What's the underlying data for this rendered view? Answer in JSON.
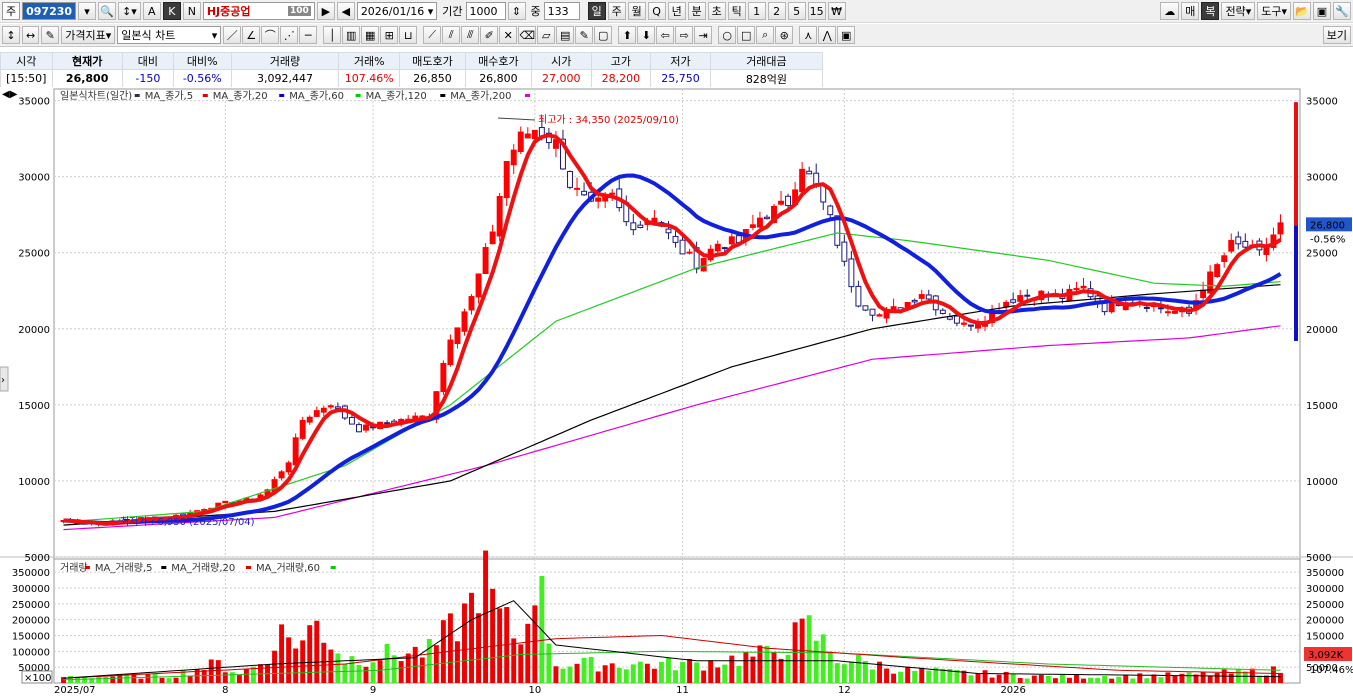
{
  "toolbar": {
    "market": "주",
    "code": "097230",
    "btn_a": "A",
    "btn_k": "K",
    "btn_n": "N",
    "stock_name": "HJ중공업",
    "name_badge": "100",
    "date": "2026/01/16",
    "period_label": "기간",
    "period_value": "1000",
    "mid_label": "중",
    "mid_value": "133",
    "intervals": [
      "일",
      "주",
      "월",
      "Q",
      "년",
      "분",
      "초",
      "틱",
      "1",
      "2",
      "5",
      "15",
      "₩"
    ],
    "right_buttons": [
      "매",
      "복",
      "전략",
      "도구"
    ],
    "indicator_btn": "가격지표",
    "chart_type": "일본식 차트",
    "view_btn": "보기"
  },
  "quote": {
    "headers": [
      "시각",
      "현재가",
      "대비",
      "대비%",
      "거래량",
      "거래%",
      "매도호가",
      "매수호가",
      "시가",
      "고가",
      "저가",
      "거래대금"
    ],
    "values": [
      "[15:50]",
      "26,800",
      "-150",
      "-0.56%",
      "3,092,447",
      "107.46%",
      "26,850",
      "26,800",
      "27,000",
      "28,200",
      "25,750",
      "828억원"
    ]
  },
  "price_legend": [
    {
      "text": "일본식차트(일간)",
      "color": "#333333"
    },
    {
      "text": "MA_종가,5",
      "color": "#e00000"
    },
    {
      "text": "MA_종가,20",
      "color": "#0000dd"
    },
    {
      "text": "MA_종가,60",
      "color": "#00cc00"
    },
    {
      "text": "MA_종가,120",
      "color": "#000000"
    },
    {
      "text": "MA_종가,200",
      "color": "#dd00dd"
    }
  ],
  "volume_legend": [
    {
      "text": "거래량",
      "color": "#e00000"
    },
    {
      "text": "MA_거래량,5",
      "color": "#000000"
    },
    {
      "text": "MA_거래량,20",
      "color": "#e00000"
    },
    {
      "text": "MA_거래량,60",
      "color": "#00cc00"
    }
  ],
  "annotations": {
    "high": "최고가 : 34,350 (2025/09/10)",
    "low": "최저가 : 6,950 (2025/07/04)",
    "price_tag": "26,800",
    "pct_tag": "-0.56%",
    "vol_tag": "3,092K",
    "vol_pct_tag": "107.46%",
    "vol_scale": "×100"
  },
  "colors": {
    "up": "#ff0000",
    "down": "#ffffff",
    "ma5": "#ee1111",
    "ma20": "#1020dd",
    "ma60": "#22cc22",
    "ma120": "#000000",
    "ma200": "#dd00dd"
  },
  "chart_data": {
    "type": "candlestick",
    "title": "일본식차트(일간)",
    "x_ticks": [
      "2025/07",
      "8",
      "9",
      "10",
      "11",
      "12",
      "2026"
    ],
    "y_ticks": [
      5000,
      10000,
      15000,
      20000,
      25000,
      30000,
      35000
    ],
    "ylim": [
      5000,
      35500
    ],
    "volume_ticks": [
      50000,
      100000,
      150000,
      200000,
      250000,
      300000,
      350000
    ],
    "volume_ylim": [
      0,
      360000
    ],
    "grid": true,
    "close_anchors": [
      [
        0,
        7400
      ],
      [
        5,
        7150
      ],
      [
        10,
        7500
      ],
      [
        15,
        7600
      ],
      [
        18,
        7900
      ],
      [
        20,
        8200
      ],
      [
        24,
        8650
      ],
      [
        27,
        8800
      ],
      [
        29,
        9400
      ],
      [
        32,
        11300
      ],
      [
        34,
        14000
      ],
      [
        36,
        14600
      ],
      [
        38,
        15100
      ],
      [
        40,
        14200
      ],
      [
        42,
        13400
      ],
      [
        46,
        13800
      ],
      [
        49,
        14100
      ],
      [
        52,
        14250
      ],
      [
        55,
        19500
      ],
      [
        58,
        22000
      ],
      [
        61,
        26500
      ],
      [
        63,
        31000
      ],
      [
        65,
        32600
      ],
      [
        67,
        33100
      ],
      [
        70,
        32200
      ],
      [
        72,
        29500
      ],
      [
        75,
        28000
      ],
      [
        78,
        28700
      ],
      [
        80,
        27000
      ],
      [
        82,
        26800
      ],
      [
        84,
        27500
      ],
      [
        87,
        25500
      ],
      [
        90,
        24300
      ],
      [
        93,
        25600
      ],
      [
        96,
        25700
      ],
      [
        99,
        27300
      ],
      [
        101,
        27800
      ],
      [
        103,
        28300
      ],
      [
        105,
        30800
      ],
      [
        107,
        29200
      ],
      [
        109,
        27200
      ],
      [
        111,
        24200
      ],
      [
        113,
        21800
      ],
      [
        116,
        20900
      ],
      [
        119,
        21400
      ],
      [
        122,
        22400
      ],
      [
        125,
        21100
      ],
      [
        128,
        20200
      ],
      [
        131,
        20800
      ],
      [
        134,
        21800
      ],
      [
        136,
        22200
      ],
      [
        139,
        22300
      ],
      [
        142,
        22100
      ],
      [
        145,
        22700
      ],
      [
        148,
        21400
      ],
      [
        151,
        22000
      ],
      [
        154,
        21700
      ],
      [
        157,
        21200
      ],
      [
        160,
        21000
      ],
      [
        162,
        22800
      ],
      [
        164,
        24100
      ],
      [
        166,
        25500
      ],
      [
        168,
        25400
      ],
      [
        170,
        24900
      ],
      [
        173,
        26800
      ]
    ],
    "ma_values": {
      "ma60": [
        [
          0,
          7300
        ],
        [
          20,
          8000
        ],
        [
          40,
          11000
        ],
        [
          55,
          15000
        ],
        [
          70,
          20500
        ],
        [
          90,
          24000
        ],
        [
          110,
          26300
        ],
        [
          120,
          25800
        ],
        [
          140,
          24500
        ],
        [
          155,
          23000
        ],
        [
          165,
          22800
        ],
        [
          173,
          23100
        ]
      ],
      "ma120": [
        [
          0,
          7100
        ],
        [
          30,
          8000
        ],
        [
          55,
          10000
        ],
        [
          75,
          14000
        ],
        [
          95,
          17500
        ],
        [
          115,
          20000
        ],
        [
          135,
          21500
        ],
        [
          155,
          22300
        ],
        [
          173,
          22900
        ]
      ],
      "ma200": [
        [
          0,
          6800
        ],
        [
          30,
          7600
        ],
        [
          60,
          11000
        ],
        [
          90,
          15000
        ],
        [
          115,
          18000
        ],
        [
          140,
          18900
        ],
        [
          160,
          19400
        ],
        [
          173,
          20200
        ]
      ]
    },
    "volume_anchors": [
      [
        0,
        20000
      ],
      [
        15,
        22000
      ],
      [
        22,
        60000
      ],
      [
        25,
        30000
      ],
      [
        29,
        70000
      ],
      [
        30,
        160000
      ],
      [
        34,
        130000
      ],
      [
        36,
        190000
      ],
      [
        40,
        75000
      ],
      [
        46,
        90000
      ],
      [
        52,
        100000
      ],
      [
        55,
        165000
      ],
      [
        57,
        215000
      ],
      [
        58,
        250000
      ],
      [
        59,
        340000
      ],
      [
        60,
        320000
      ],
      [
        62,
        200000
      ],
      [
        64,
        160000
      ],
      [
        65,
        120000
      ],
      [
        67,
        360000
      ],
      [
        70,
        60000
      ],
      [
        80,
        60000
      ],
      [
        90,
        60000
      ],
      [
        100,
        90000
      ],
      [
        106,
        170000
      ],
      [
        110,
        80000
      ],
      [
        120,
        40000
      ],
      [
        140,
        20000
      ],
      [
        160,
        25000
      ],
      [
        173,
        40000
      ]
    ],
    "volume_ma_values": {
      "ma5": [
        [
          0,
          15000
        ],
        [
          30,
          60000
        ],
        [
          50,
          80000
        ],
        [
          58,
          200000
        ],
        [
          64,
          260000
        ],
        [
          70,
          120000
        ],
        [
          90,
          70000
        ],
        [
          110,
          70000
        ],
        [
          130,
          30000
        ],
        [
          173,
          20000
        ]
      ],
      "ma20": [
        [
          0,
          15000
        ],
        [
          40,
          60000
        ],
        [
          55,
          100000
        ],
        [
          70,
          140000
        ],
        [
          85,
          150000
        ],
        [
          100,
          110000
        ],
        [
          120,
          80000
        ],
        [
          150,
          40000
        ],
        [
          173,
          30000
        ]
      ],
      "ma60": [
        [
          0,
          10000
        ],
        [
          45,
          40000
        ],
        [
          65,
          90000
        ],
        [
          85,
          100000
        ],
        [
          110,
          95000
        ],
        [
          140,
          60000
        ],
        [
          173,
          40000
        ]
      ]
    }
  }
}
